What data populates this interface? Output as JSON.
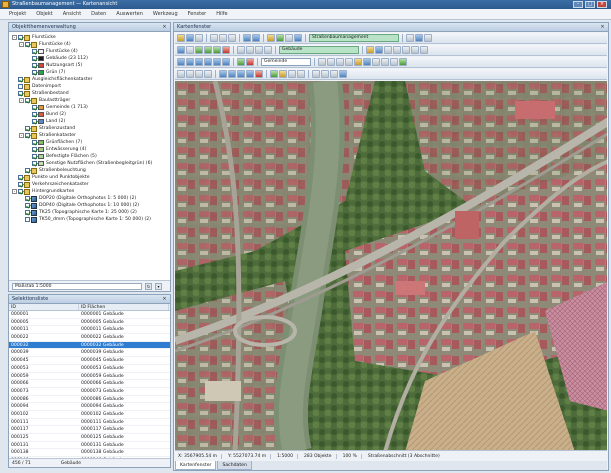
{
  "window": {
    "title": "Straßenbaumanagement — Kartenansicht"
  },
  "menu": [
    "Projekt",
    "Objekt",
    "Ansicht",
    "Daten",
    "Auswerten",
    "Werkzeug",
    "Fenster",
    "Hilfe"
  ],
  "toc": {
    "title": "Objektthemenverwaltung",
    "items": [
      {
        "indent": 0,
        "kind": "toggle",
        "toggle": "-",
        "checked": true,
        "label": "Flurstücke"
      },
      {
        "indent": 1,
        "kind": "toggle",
        "toggle": "-",
        "checked": true,
        "label": "Flurstücke (4)"
      },
      {
        "indent": 2,
        "kind": "swatch",
        "color": "#f3f3f3",
        "checked": true,
        "label": "Flurstücke (4)"
      },
      {
        "indent": 2,
        "kind": "swatch",
        "color": "#1b1b1b",
        "checked": true,
        "label": "Gebäude (23 112)"
      },
      {
        "indent": 2,
        "kind": "swatch",
        "color": "#c84a3a",
        "checked": true,
        "label": "Nutzungsart (5)"
      },
      {
        "indent": 2,
        "kind": "swatch",
        "color": "#27a352",
        "checked": true,
        "label": "Grün (7)"
      },
      {
        "indent": 0,
        "kind": "group",
        "checked": true,
        "label": "Ausgleichsflächenkataster"
      },
      {
        "indent": 0,
        "kind": "group",
        "checked": false,
        "label": "Datenimport"
      },
      {
        "indent": 0,
        "kind": "group",
        "checked": true,
        "label": "Straßenbestand"
      },
      {
        "indent": 1,
        "kind": "toggle",
        "toggle": "-",
        "checked": true,
        "label": "Baulastträger"
      },
      {
        "indent": 2,
        "kind": "swatch",
        "color": "#e19a3c",
        "checked": true,
        "label": "Gemeinde (1 713)"
      },
      {
        "indent": 2,
        "kind": "swatch",
        "color": "#d45d45",
        "checked": true,
        "label": "Bund (2)"
      },
      {
        "indent": 2,
        "kind": "swatch",
        "color": "#5e86c4",
        "checked": true,
        "label": "Land (2)"
      },
      {
        "indent": 1,
        "kind": "group",
        "checked": true,
        "label": "Straßenzustand"
      },
      {
        "indent": 1,
        "kind": "toggle",
        "toggle": "-",
        "checked": true,
        "label": "Straßenkataster"
      },
      {
        "indent": 2,
        "kind": "swatch",
        "color": "#7fbf6a",
        "checked": true,
        "label": "Grünflächen (7)"
      },
      {
        "indent": 2,
        "kind": "swatch",
        "color": "#9fcf8a",
        "checked": true,
        "label": "Entwässerung (4)"
      },
      {
        "indent": 2,
        "kind": "swatch",
        "color": "#a9d59a",
        "checked": true,
        "label": "Befestigte Flächen (5)"
      },
      {
        "indent": 2,
        "kind": "swatch",
        "color": "#c1dfb2",
        "checked": true,
        "label": "Sonstige Nutzflächen (Straßenbegleitgrün) (6)"
      },
      {
        "indent": 1,
        "kind": "group",
        "checked": true,
        "label": "Straßenbeleuchtung"
      },
      {
        "indent": 0,
        "kind": "group",
        "checked": true,
        "label": "Punkte und Punktobjekte"
      },
      {
        "indent": 0,
        "kind": "group",
        "checked": true,
        "label": "Verkehrszeichenkataster"
      },
      {
        "indent": 0,
        "kind": "toggle",
        "toggle": "-",
        "checked": true,
        "label": "Hintergrundkarten"
      },
      {
        "indent": 1,
        "kind": "layer",
        "checked": true,
        "label": "DOP20 (Digitale Orthophotos 1: 5 000) (2)"
      },
      {
        "indent": 1,
        "kind": "layer",
        "checked": true,
        "label": "DOP40 (Digitale Orthophotos 1: 10 000) (2)"
      },
      {
        "indent": 1,
        "kind": "layer",
        "checked": true,
        "label": "TK25 (Topographische Karte 1: 25 000) (2)"
      },
      {
        "indent": 1,
        "kind": "layer",
        "checked": false,
        "label": "TK50_dmm (Topographische Karte 1: 50 000) (2)"
      }
    ],
    "status_field": "Maßstab 1:5000"
  },
  "selection": {
    "title": "Selektionsliste",
    "columns": [
      "ID",
      "ID Flächen"
    ],
    "rows": [
      [
        "000001",
        "0000001 Gebäude"
      ],
      [
        "000005",
        "0000005 Gebäude"
      ],
      [
        "000011",
        "0000011 Gebäude"
      ],
      [
        "000022",
        "0000022 Gebäude"
      ],
      [
        "000032",
        "0000032 Gebäude"
      ],
      [
        "000039",
        "0000039 Gebäude"
      ],
      [
        "000045",
        "0000045 Gebäude"
      ],
      [
        "000053",
        "0000053 Gebäude"
      ],
      [
        "000059",
        "0000059 Gebäude"
      ],
      [
        "000066",
        "0000066 Gebäude"
      ],
      [
        "000073",
        "0000073 Gebäude"
      ],
      [
        "000086",
        "0000086 Gebäude"
      ],
      [
        "000094",
        "0000094 Gebäude"
      ],
      [
        "000102",
        "0000102 Gebäude"
      ],
      [
        "000111",
        "0000111 Gebäude"
      ],
      [
        "000117",
        "0000117 Gebäude"
      ],
      [
        "000125",
        "0000125 Gebäude"
      ],
      [
        "000131",
        "0000131 Gebäude"
      ],
      [
        "000138",
        "0000138 Gebäude"
      ],
      [
        "000146",
        "0000146 Gebäude"
      ]
    ],
    "selected_index": 4,
    "status_left": "456 / 71",
    "status_right": "Gebäude"
  },
  "map": {
    "title": "Kartenfenster",
    "toolbar1_combo": "Straßenbaumanagement",
    "toolbar2_combo": "Gebäude",
    "toolbar2_combo_b": "Gemeinde",
    "status": {
      "x": "X: 3567905.54 m",
      "y": "Y: 5527073.74 m",
      "scale": "1:5000",
      "selected": "283 Objekte",
      "zoom": "100 %",
      "extra": "Straßenabschnitt (3 Abschnitte)"
    },
    "tabs": [
      "Kartenfenster",
      "Sachdaten"
    ]
  },
  "colors": {
    "accent": "#2f7dd1",
    "titlebar": "#2b5a8e",
    "panel_border": "#8da2bb"
  }
}
